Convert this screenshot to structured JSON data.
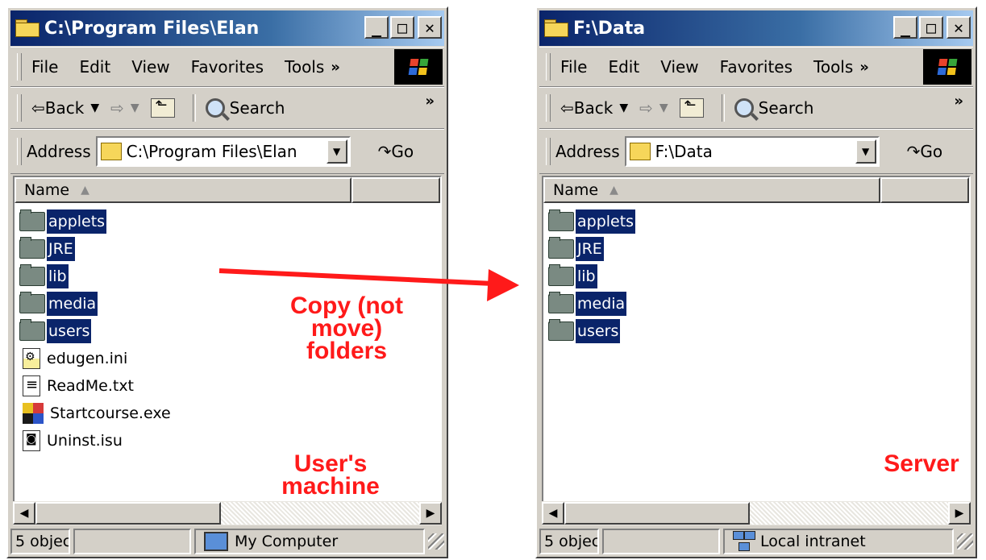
{
  "colors": {
    "title_gradient_start": "#0a246a",
    "title_gradient_end": "#a6caf0",
    "selection": "#0a246a",
    "annotation_red": "#ff1a1a",
    "window_face": "#d4d0c8"
  },
  "left_window": {
    "title": "C:\\Program Files\\Elan",
    "menu": [
      "File",
      "Edit",
      "View",
      "Favorites",
      "Tools"
    ],
    "toolbar": {
      "back": "Back",
      "search": "Search"
    },
    "address_label": "Address",
    "address_value": "C:\\Program Files\\Elan",
    "go_label": "Go",
    "column_name": "Name",
    "items": [
      {
        "name": "applets",
        "type": "folder",
        "selected": true
      },
      {
        "name": "JRE",
        "type": "folder",
        "selected": true
      },
      {
        "name": "lib",
        "type": "folder",
        "selected": true
      },
      {
        "name": "media",
        "type": "folder",
        "selected": true
      },
      {
        "name": "users",
        "type": "folder",
        "selected": true
      },
      {
        "name": "edugen.ini",
        "type": "ini",
        "selected": false
      },
      {
        "name": "ReadMe.txt",
        "type": "txt",
        "selected": false
      },
      {
        "name": "Startcourse.exe",
        "type": "exe",
        "selected": false
      },
      {
        "name": "Uninst.isu",
        "type": "isu",
        "selected": false
      }
    ],
    "status_count": "5 objec",
    "status_zone": "My Computer"
  },
  "right_window": {
    "title": "F:\\Data",
    "menu": [
      "File",
      "Edit",
      "View",
      "Favorites",
      "Tools"
    ],
    "toolbar": {
      "back": "Back",
      "search": "Search"
    },
    "address_label": "Address",
    "address_value": "F:\\Data",
    "go_label": "Go",
    "column_name": "Name",
    "items": [
      {
        "name": "applets",
        "type": "folder",
        "selected": true
      },
      {
        "name": "JRE",
        "type": "folder",
        "selected": true
      },
      {
        "name": "lib",
        "type": "folder",
        "selected": true
      },
      {
        "name": "media",
        "type": "folder",
        "selected": true
      },
      {
        "name": "users",
        "type": "folder",
        "selected": true
      }
    ],
    "status_count": "5 objec",
    "status_zone": "Local intranet"
  },
  "annotations": {
    "copy_line1": "Copy (not move)",
    "copy_line2": "folders",
    "left_label": "User's machine",
    "right_label": "Server"
  }
}
